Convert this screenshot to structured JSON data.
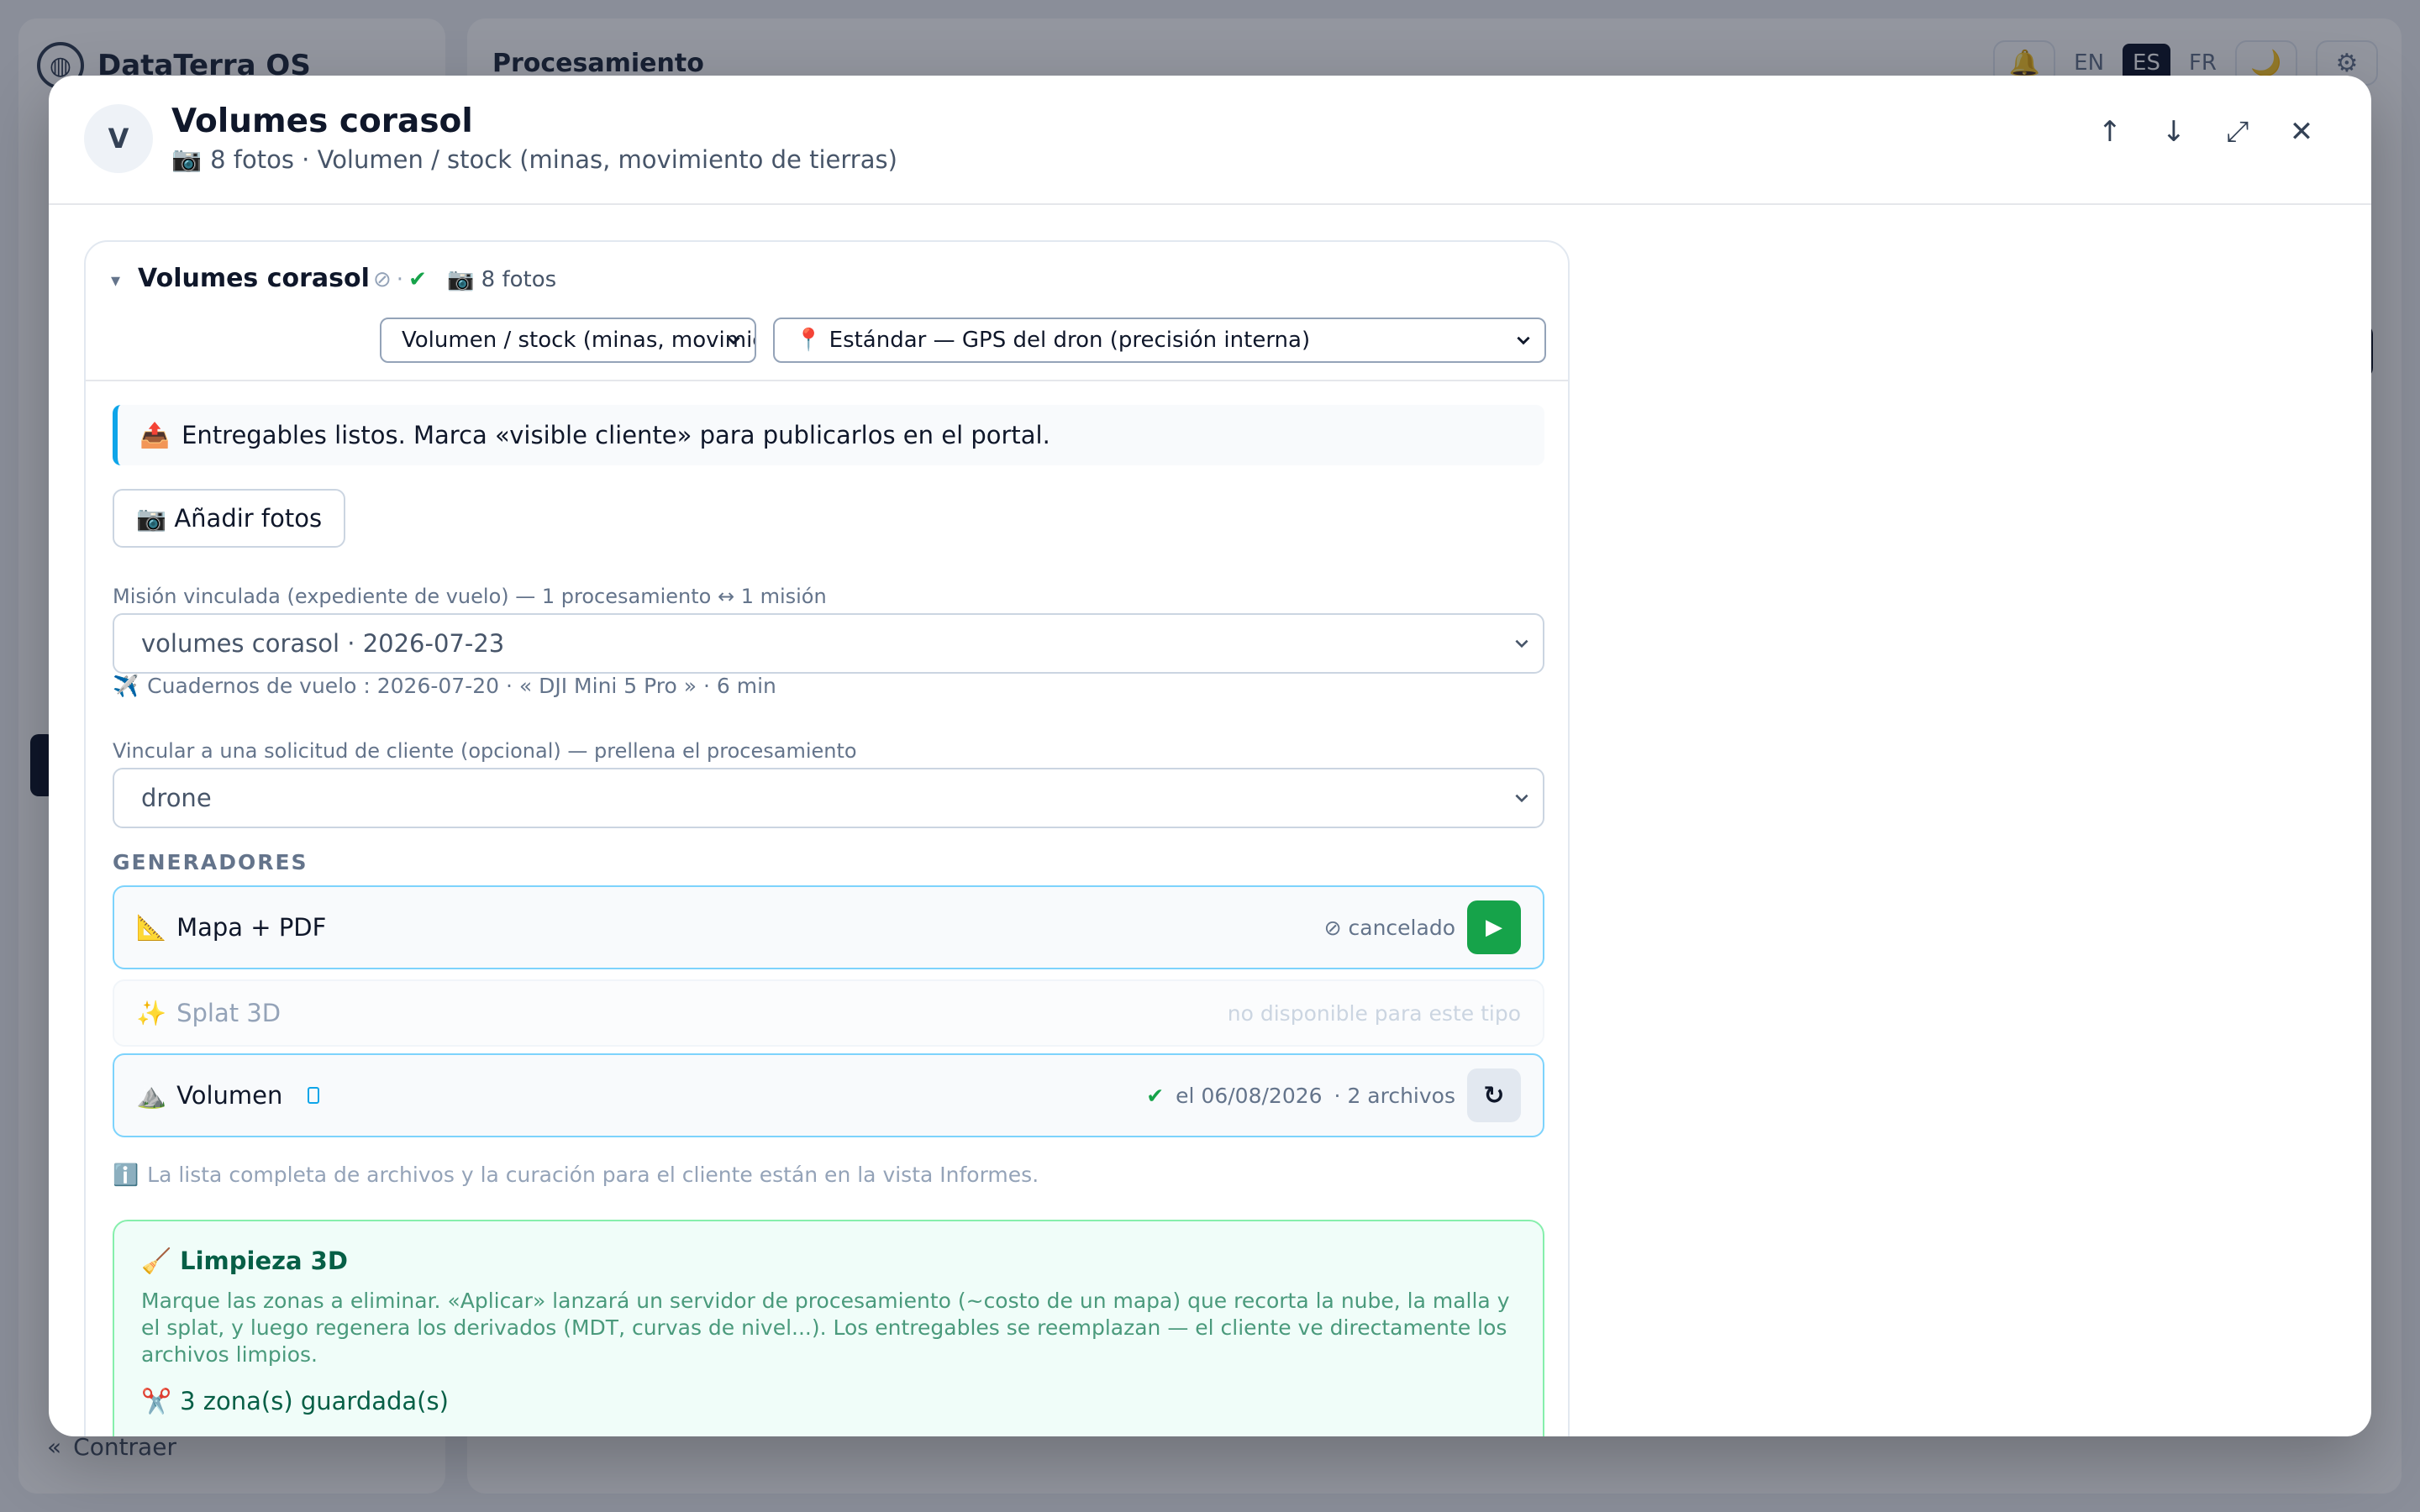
{
  "background": {
    "brand": "DataTerra OS",
    "page_title": "Procesamiento",
    "languages": [
      "EN",
      "ES",
      "FR"
    ],
    "active_language": "ES",
    "collapse_label": "Contraer"
  },
  "modal": {
    "avatar_letter": "V",
    "title": "Volumes corasol",
    "subtitle_icon": "📷",
    "subtitle": "8 fotos · Volumen / stock (minas, movimiento de tierras)",
    "actions": {
      "up": "↑",
      "down": "↓",
      "expand": "⤢",
      "close": "✕"
    }
  },
  "card": {
    "caret": "▾",
    "title": "Volumes corasol",
    "status_cancel": "⊘",
    "status_sep": "·",
    "status_ok": "✔",
    "photo_count": "📷 8 fotos",
    "type_select": "Volumen / stock (minas, movimiento de tierras)",
    "gps_select": "📍 Estándar — GPS del dron (precisión interna)",
    "notice_icon": "📤",
    "notice": "Entregables listos. Marca «visible cliente» para publicarlos en el portal.",
    "add_photos": "📷 Añadir fotos",
    "mission_label": "Misión vinculada (expediente de vuelo) — 1 procesamiento ↔ 1 misión",
    "mission_value": "volumes corasol · 2026-07-23",
    "flight_note_icon": "✈️",
    "flight_note": "Cuadernos de vuelo : 2026-07-20 · « DJI Mini 5 Pro » · 6 min",
    "request_label": "Vincular a una solicitud de cliente (opcional) — prellena el procesamiento",
    "request_value": "drone",
    "generators_title": "GENERADORES",
    "generators": [
      {
        "icon": "📐",
        "name": "Mapa + PDF",
        "status": "⊘ cancelado",
        "action": "▶"
      },
      {
        "icon": "✨",
        "name": "Splat 3D",
        "status": "no disponible para este tipo"
      },
      {
        "icon": "⛰️",
        "name": "Volumen",
        "status_ok": "✔",
        "status": "el 06/08/2026",
        "files": "· 2 archivos",
        "action": "↻"
      }
    ],
    "info_icon": "ℹ️",
    "info": "La lista completa de archivos y la curación para el cliente están en la vista Informes.",
    "cleanup": {
      "icon": "🧹",
      "title": "Limpieza 3D",
      "text": "Marque las zonas a eliminar. «Aplicar» lanzará un servidor de procesamiento (~costo de un mapa) que recorta la nube, la malla y el splat, y luego regenera los derivados (MDT, curvas de nivel...). Los entregables se reemplazan — el cliente ve directamente los archivos limpios.",
      "zones_icon": "✂️",
      "zones": "3 zona(s) guardada(s)"
    }
  },
  "colors": {
    "accent_blue": "#0ea5e9",
    "success_green": "#16a34a",
    "cleanup_border": "#86efac"
  }
}
